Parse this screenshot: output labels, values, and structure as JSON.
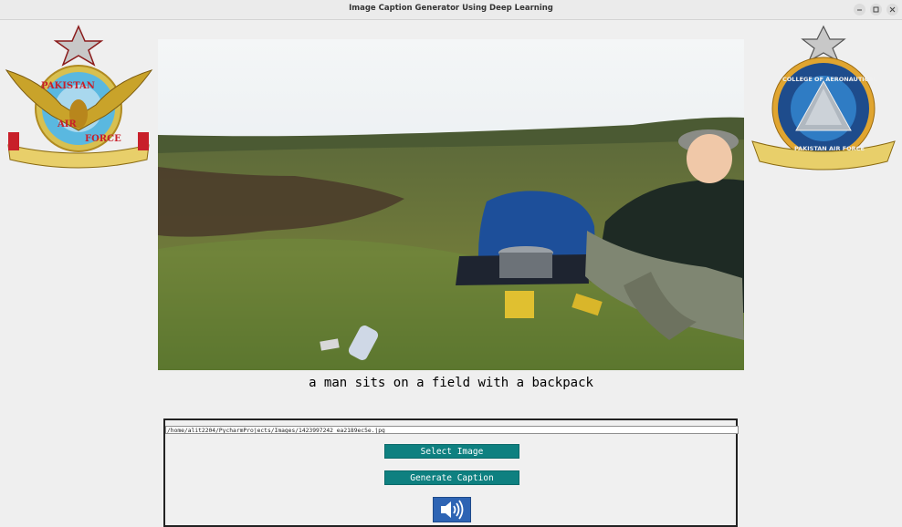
{
  "window": {
    "title": "Image Caption Generator Using Deep Learning"
  },
  "caption": {
    "text": "a man sits on a field with a backpack"
  },
  "controls": {
    "file_path": "/home/alit2204/PycharmProjects/Images/1423997242_ea2189ec5e.jpg",
    "select_label": "Select Image",
    "generate_label": "Generate Caption"
  },
  "logos": {
    "left": "Pakistan Air Force",
    "right": "College of Aeronautical Engineering — Pakistan Air Force"
  },
  "colors": {
    "button_teal": "#0e8080",
    "speaker_blue": "#2e64b4"
  },
  "icons": {
    "speaker": "speaker-icon"
  }
}
